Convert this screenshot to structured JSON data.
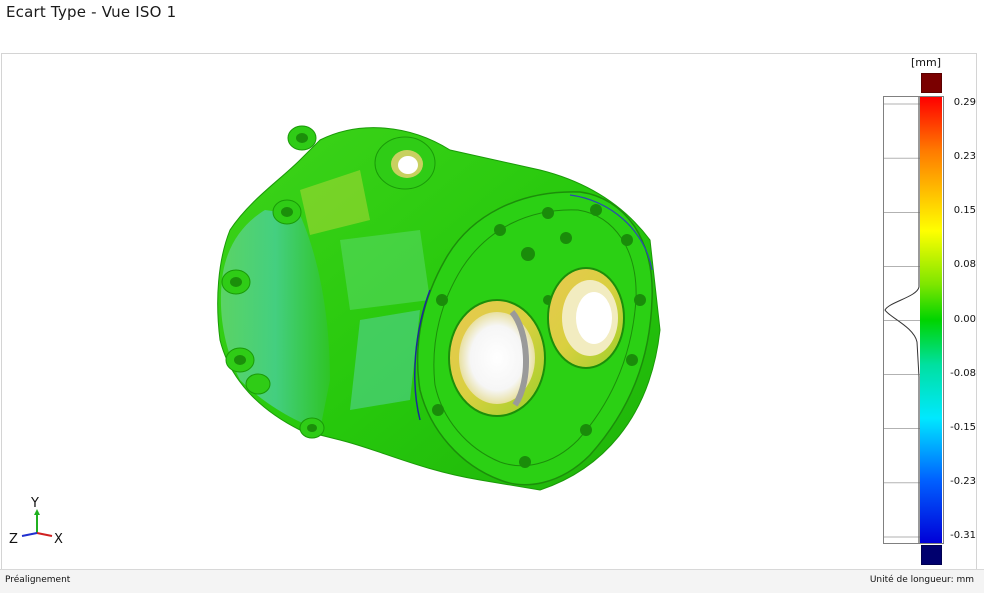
{
  "window": {
    "title": "Ecart Type - Vue ISO 1"
  },
  "color_scale": {
    "unit": "[mm]",
    "max_color": "#7a0000",
    "min_color": "#00006e",
    "ticks": [
      {
        "label": "0.29",
        "value": 0.29
      },
      {
        "label": "0.23",
        "value": 0.23
      },
      {
        "label": "0.15",
        "value": 0.15
      },
      {
        "label": "0.08",
        "value": 0.08
      },
      {
        "label": "0.00",
        "value": 0.0
      },
      {
        "label": "-0.08",
        "value": -0.08
      },
      {
        "label": "-0.15",
        "value": -0.15
      },
      {
        "label": "-0.23",
        "value": -0.23
      },
      {
        "label": "-0.31",
        "value": -0.31
      }
    ]
  },
  "axis_triad": {
    "y": "Y",
    "z": "Z",
    "x": "X"
  },
  "statusbar": {
    "left": "Préalignement",
    "right": "Unité de longueur: mm"
  }
}
